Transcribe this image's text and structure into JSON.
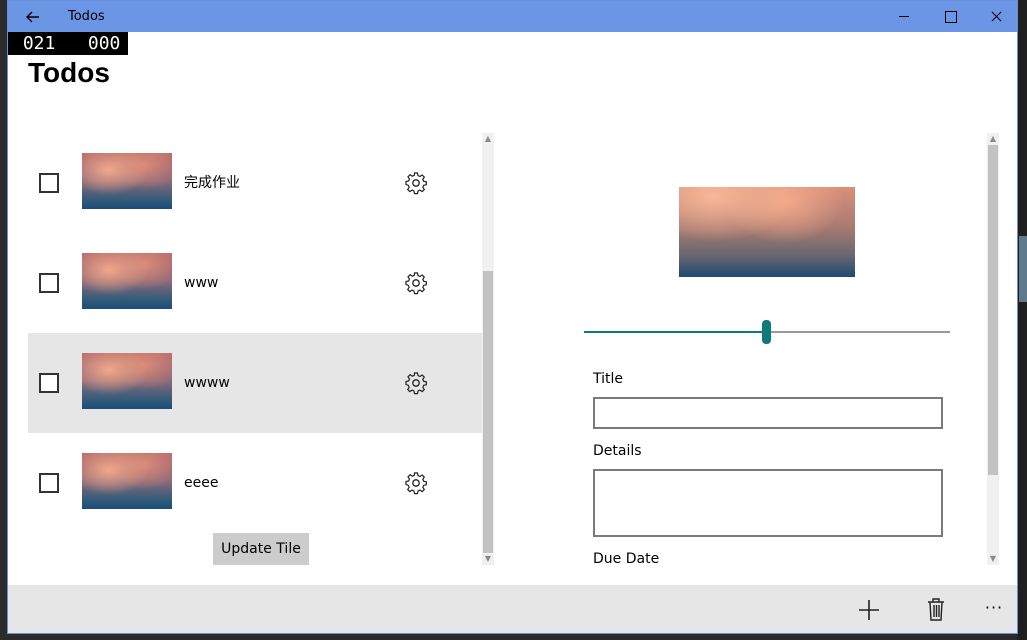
{
  "window": {
    "title": "Todos",
    "back_icon": "arrow-left-icon",
    "controls": [
      "minimize-icon",
      "maximize-icon",
      "close-icon"
    ]
  },
  "counter": {
    "text": " 021   000"
  },
  "page": {
    "title": "Todos"
  },
  "todos": [
    {
      "label": "完成作业",
      "checked": false,
      "selected": false,
      "settings_icon": "gear-icon"
    },
    {
      "label": "www",
      "checked": false,
      "selected": false,
      "settings_icon": "gear-icon"
    },
    {
      "label": "wwww",
      "checked": false,
      "selected": true,
      "settings_icon": "gear-icon"
    },
    {
      "label": "eeee",
      "checked": false,
      "selected": false,
      "settings_icon": "gear-icon"
    }
  ],
  "update_tile_label": "Update Tile",
  "detail": {
    "slider_value": 0.5,
    "title_label": "Title",
    "title_value": "",
    "details_label": "Details",
    "details_value": "",
    "due_date_label": "Due Date"
  },
  "appbar": {
    "add_icon": "plus-icon",
    "delete_icon": "trash-icon",
    "more_text": "···"
  },
  "colors": {
    "titlebar": "#6b96e6",
    "accent": "#0e7a7a",
    "selected_row": "#e6e6e6",
    "appbar": "#e6e6e6"
  }
}
